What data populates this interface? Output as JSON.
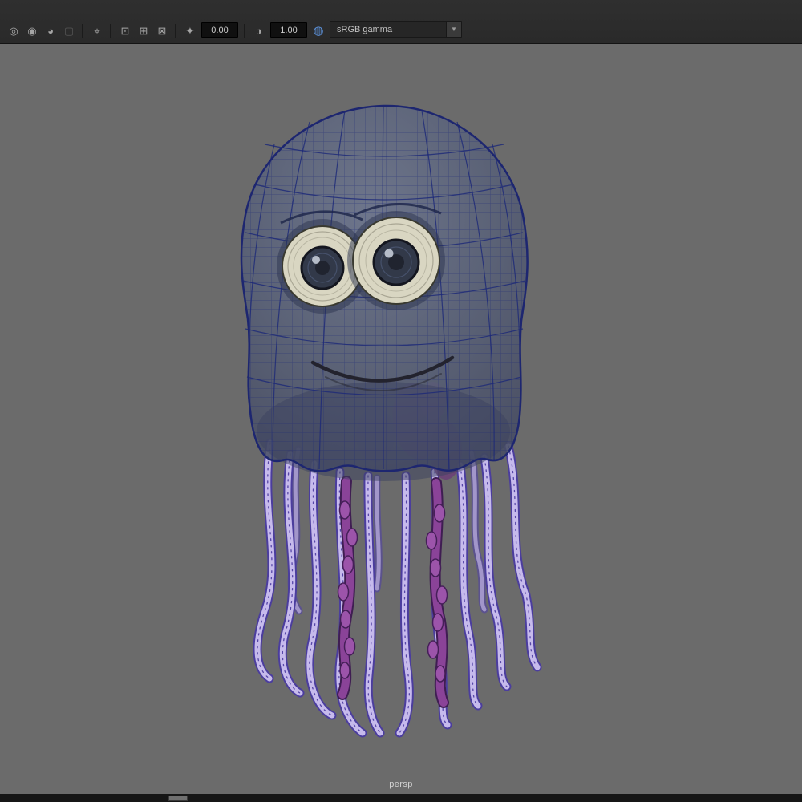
{
  "toolbar": {
    "icons": [
      {
        "name": "highlight-selection-icon",
        "glyph": "◎"
      },
      {
        "name": "ambient-occlusion-icon",
        "glyph": "◉"
      },
      {
        "name": "motion-blur-icon",
        "glyph": "◕"
      },
      {
        "name": "multisample-icon",
        "glyph": "▢"
      },
      {
        "name": "snap-select-icon",
        "glyph": "⌖"
      },
      {
        "name": "image-plane-icon",
        "glyph": "⊡"
      },
      {
        "name": "texture-display-icon",
        "glyph": "⊞"
      },
      {
        "name": "gate-mask-icon",
        "glyph": "⊠"
      },
      {
        "name": "exposure-icon",
        "glyph": "✦"
      },
      {
        "name": "gamma-icon",
        "glyph": "◑"
      },
      {
        "name": "color-management-icon",
        "glyph": "◍"
      }
    ],
    "exposure_value": "0.00",
    "gamma_value": "1.00",
    "view_transform": "sRGB gamma",
    "dropdown_arrow": "▼"
  },
  "viewport": {
    "camera_label": "persp",
    "background_color": "#6b6b6b"
  },
  "scene": {
    "colors": {
      "wireframe": "#1c2878",
      "bell_fill": "#5c6378",
      "tentacle_fill": "#c6baec",
      "tentacle_outline": "#4b3d9e",
      "inner_tentacle": "#8a4398",
      "organ": "#7a4186",
      "eye_sclera": "#d9d6c2",
      "eye_iris": "#323949"
    }
  }
}
